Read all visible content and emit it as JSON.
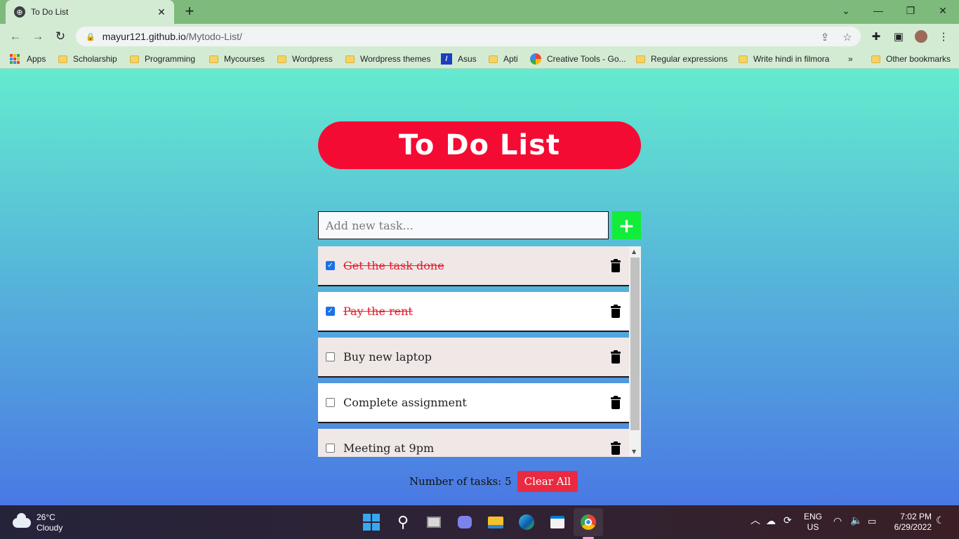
{
  "browser": {
    "tab_title": "To Do List",
    "tab_close": "✕",
    "new_tab": "+",
    "url_host": "mayur121.github.io",
    "url_path": "/Mytodo-List/",
    "bookmarks": [
      {
        "label": "Apps",
        "icon": "apps-grid-icon"
      },
      {
        "label": "Scholarship",
        "icon": "folder-icon"
      },
      {
        "label": "Programming",
        "icon": "folder-icon"
      },
      {
        "label": "Mycourses",
        "icon": "folder-icon"
      },
      {
        "label": "Wordpress",
        "icon": "folder-icon"
      },
      {
        "label": "Wordpress themes",
        "icon": "folder-icon"
      },
      {
        "label": "Asus",
        "icon": "asus-icon"
      },
      {
        "label": "Apti",
        "icon": "folder-icon"
      },
      {
        "label": "Creative Tools - Go...",
        "icon": "creative-tools-icon"
      },
      {
        "label": "Regular expressions",
        "icon": "folder-icon"
      },
      {
        "label": "Write hindi in filmora",
        "icon": "folder-icon"
      },
      {
        "label": "Other bookmarks",
        "icon": "folder-icon"
      }
    ],
    "overflow": "»"
  },
  "app": {
    "heading": "To Do List",
    "input_placeholder": "Add new task...",
    "add_button": "+",
    "tasks": [
      {
        "label": "Get the task done",
        "done": true
      },
      {
        "label": "Pay the rent",
        "done": true
      },
      {
        "label": "Buy new laptop",
        "done": false
      },
      {
        "label": "Complete assignment",
        "done": false
      },
      {
        "label": "Meeting at 9pm",
        "done": false
      }
    ],
    "count_label": "Number of tasks: 5",
    "clear_button": "Clear All"
  },
  "taskbar": {
    "temperature": "26°C",
    "condition": "Cloudy",
    "language": "ENG",
    "region": "US",
    "time": "7:02 PM",
    "date": "6/29/2022"
  },
  "colors": {
    "heading_bg": "#f40b33",
    "add_button_bg": "#12ec3a",
    "clear_button_bg": "#ea2a41",
    "done_text": "#e31b2d",
    "browser_frame": "#7dba7c"
  }
}
